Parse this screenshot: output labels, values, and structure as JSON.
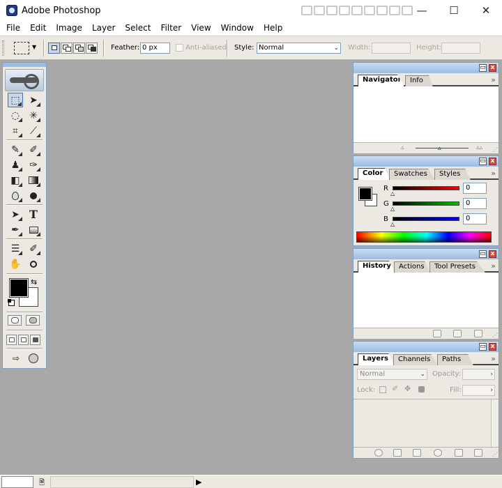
{
  "app": {
    "title": "Adobe Photoshop"
  },
  "window_controls": {
    "minimize": "—",
    "maximize": "☐",
    "close": "✕"
  },
  "menu": [
    "File",
    "Edit",
    "Image",
    "Layer",
    "Select",
    "Filter",
    "View",
    "Window",
    "Help"
  ],
  "options": {
    "feather_label": "Feather:",
    "feather_value": "0 px",
    "anti_aliased_label": "Anti-aliased",
    "style_label": "Style:",
    "style_value": "Normal",
    "width_label": "Width:",
    "height_label": "Height:"
  },
  "tools": [
    "rectangular-marquee",
    "move",
    "lasso",
    "magic-wand",
    "crop",
    "slice",
    "healing-brush",
    "brush",
    "clone-stamp",
    "history-brush",
    "eraser",
    "gradient",
    "blur",
    "dodge",
    "path-selection",
    "type",
    "pen",
    "rectangle-shape",
    "notes",
    "eyedropper",
    "hand",
    "zoom"
  ],
  "tool_glyphs": [
    "⬚",
    "➤",
    "◌",
    "✳",
    "⌗",
    "⟋",
    "✎",
    "✐",
    "♟",
    "✑",
    "◧",
    "▬",
    "●",
    "●",
    "➤",
    "T",
    "✒",
    "▭",
    "☰",
    "✐",
    "✋",
    "🔍"
  ],
  "type_glyph": "T",
  "colors": {
    "foreground": "#000000",
    "background": "#ffffff",
    "panel_accent": "#9cbbe0",
    "close_red": "#d84a3a"
  },
  "palettes": {
    "navigator": {
      "tabs": [
        "Navigator",
        "Info"
      ]
    },
    "color": {
      "tabs": [
        "Color",
        "Swatches",
        "Styles"
      ],
      "channels": [
        {
          "label": "R",
          "value": "0",
          "color": "#ff0000"
        },
        {
          "label": "G",
          "value": "0",
          "color": "#00c000"
        },
        {
          "label": "B",
          "value": "0",
          "color": "#0000ff"
        }
      ]
    },
    "history": {
      "tabs": [
        "History",
        "Actions",
        "Tool Presets"
      ]
    },
    "layers": {
      "tabs": [
        "Layers",
        "Channels",
        "Paths"
      ],
      "blend_mode": "Normal",
      "opacity_label": "Opacity:",
      "lock_label": "Lock:",
      "fill_label": "Fill:"
    },
    "menu_glyph": "»",
    "minimize_glyph": "▭",
    "close_glyph": "x"
  },
  "status": {
    "arrow": "▶"
  }
}
